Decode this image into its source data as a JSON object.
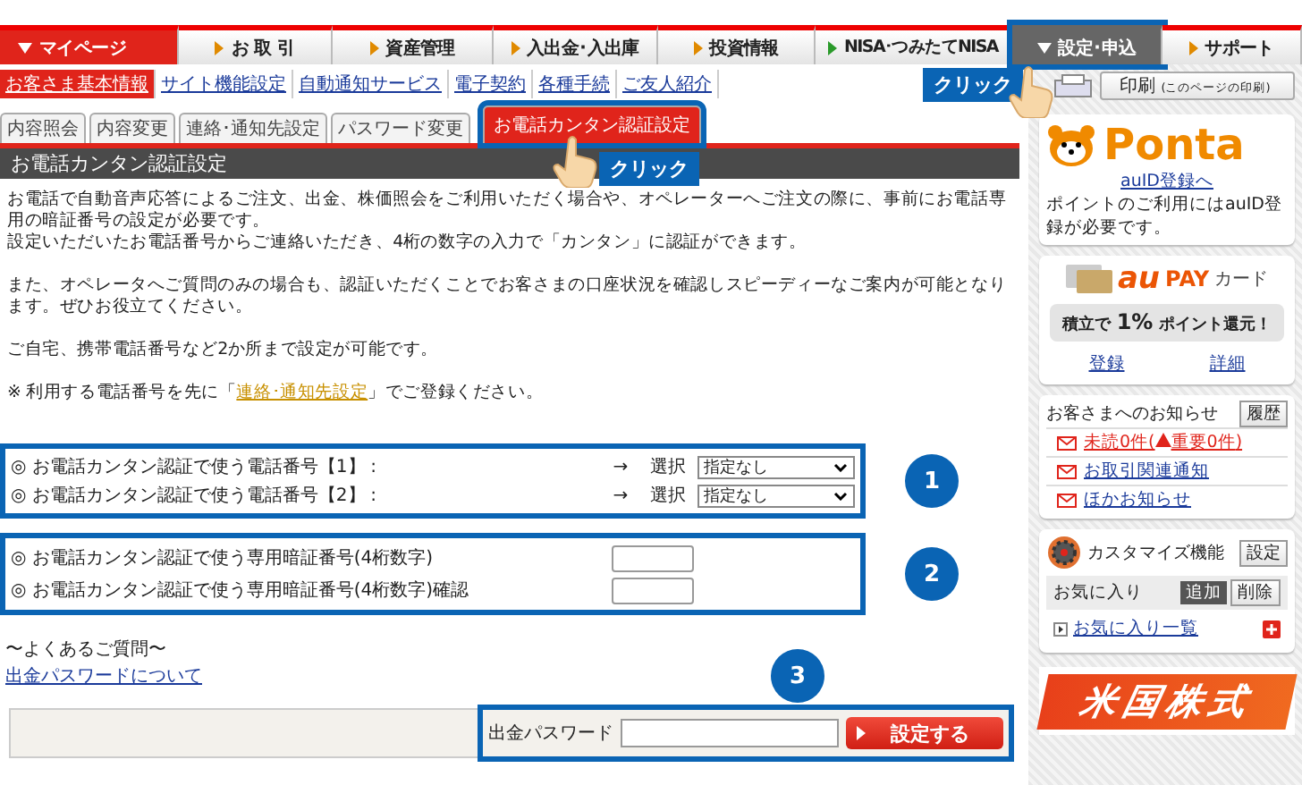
{
  "nav": [
    {
      "label": "マイページ",
      "selected": true,
      "highlighted": false
    },
    {
      "label": "お 取 引",
      "selected": false,
      "highlighted": false
    },
    {
      "label": "資産管理",
      "selected": false,
      "highlighted": false
    },
    {
      "label": "入出金･入出庫",
      "selected": false,
      "highlighted": false
    },
    {
      "label": "投資情報",
      "selected": false,
      "highlighted": false
    },
    {
      "label": "NISA･つみたてNISA",
      "selected": false,
      "highlighted": false
    },
    {
      "label": "設定･申込",
      "selected": false,
      "highlighted": true,
      "callout": "クリック"
    },
    {
      "label": "サポート",
      "selected": false,
      "highlighted": false
    }
  ],
  "subnav": [
    {
      "label": "お客さま基本情報",
      "selected": true
    },
    {
      "label": "サイト機能設定",
      "selected": false
    },
    {
      "label": "自動通知サービス",
      "selected": false
    },
    {
      "label": "電子契約",
      "selected": false
    },
    {
      "label": "各種手続",
      "selected": false
    },
    {
      "label": "ご友人紹介",
      "selected": false
    }
  ],
  "print_button": {
    "label": "印刷",
    "note": "(このページの印刷)"
  },
  "tabs": [
    {
      "label": "内容照会",
      "selected": false,
      "highlighted": false
    },
    {
      "label": "内容変更",
      "selected": false,
      "highlighted": false
    },
    {
      "label": "連絡･通知先設定",
      "selected": false,
      "highlighted": false
    },
    {
      "label": "パスワード変更",
      "selected": false,
      "highlighted": false
    },
    {
      "label": "お電話カンタン認証設定",
      "selected": true,
      "highlighted": true,
      "callout": "クリック"
    }
  ],
  "section_title": "お電話カンタン認証設定",
  "intro": [
    {
      "kind": "text",
      "text": "お電話で自動音声応答によるご注文、出金、株価照会をご利用いただく場合や、オペレーターへご注文の際に、事前にお電話専用の暗証番号の設定が必要です。"
    },
    {
      "kind": "text",
      "text": "設定いただいたお電話番号からご連絡いただき、4桁の数字の入力で「カンタン」に認証ができます。"
    },
    {
      "kind": "gap"
    },
    {
      "kind": "text",
      "text": "また、オペレータへご質問のみの場合も、認証いただくことでお客さまの口座状況を確認しスピーディーなご案内が可能となります。ぜひお役立てください。"
    },
    {
      "kind": "gap"
    },
    {
      "kind": "text",
      "text": "ご自宅、携帯電話番号など2か所まで設定が可能です。"
    },
    {
      "kind": "gap"
    },
    {
      "kind": "link",
      "before": "※ 利用する電話番号を先に「",
      "link": "連絡･通知先設定",
      "after": "」でご登録ください。"
    }
  ],
  "phone_section": {
    "step": "1",
    "rows": [
      {
        "label": "◎ お電話カンタン認証で使う電話番号【1】",
        "colon": ":",
        "arrow": "→",
        "select_label": "選択",
        "value": "指定なし"
      },
      {
        "label": "◎ お電話カンタン認証で使う電話番号【2】",
        "colon": ":",
        "arrow": "→",
        "select_label": "選択",
        "value": "指定なし"
      }
    ]
  },
  "pin_section": {
    "step": "2",
    "rows": [
      {
        "label": "◎ お電話カンタン認証で使う専用暗証番号(4桁数字)"
      },
      {
        "label": "◎ お電話カンタン認証で使う専用暗証番号(4桁数字)確認"
      }
    ]
  },
  "faq": {
    "heading": "〜よくあるご質問〜",
    "link": "出金パスワードについて"
  },
  "withdraw": {
    "step": "3",
    "label": "出金パスワード",
    "button": "設定する"
  },
  "ponta": {
    "logo": "Ponta",
    "link": "auID登録へ",
    "text": "ポイントのご利用にはauID登録が必要です。"
  },
  "aupay": {
    "logo_au": "au",
    "logo_pay": "PAY",
    "logo_card": "カード",
    "banner_before": "積立で",
    "banner_rate": "1%",
    "banner_after": "ポイント還元！",
    "links": [
      "登録",
      "詳細"
    ]
  },
  "notices": {
    "title": "お客さまへのお知らせ",
    "button": "履歴",
    "items": [
      {
        "kind": "unread",
        "before": "未読0件(",
        "warning": "重要0件",
        "after": ")"
      },
      {
        "kind": "plain",
        "text": "お取引関連通知"
      },
      {
        "kind": "plain",
        "text": "ほかお知らせ"
      }
    ]
  },
  "customize": {
    "title": "カスタマイズ機能",
    "button": "設定",
    "favorites_label": "お気に入り",
    "actions": [
      "追加",
      "削除"
    ],
    "link": "お気に入り一覧"
  },
  "banner": "米国株式"
}
